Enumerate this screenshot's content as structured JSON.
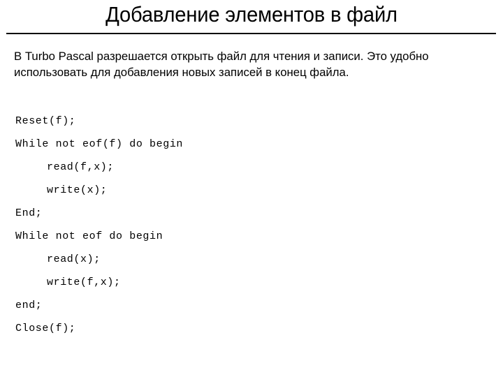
{
  "slide": {
    "title": "Добавление элементов в файл",
    "body_paragraph": "В Turbo Pascal разрешается открыть файл для чтения и записи. Это удобно использовать для добавления новых записей в конец файла.",
    "code_lines": [
      {
        "text": "Reset(f);",
        "indent": false
      },
      {
        "text": "While not eof(f) do begin",
        "indent": false
      },
      {
        "text": "read(f,x);",
        "indent": true
      },
      {
        "text": "write(x);",
        "indent": true
      },
      {
        "text": "End;",
        "indent": false
      },
      {
        "text": "While not eof do begin",
        "indent": false
      },
      {
        "text": "read(x);",
        "indent": true
      },
      {
        "text": "write(f,x);",
        "indent": true
      },
      {
        "text": "end;",
        "indent": false
      },
      {
        "text": "Close(f);",
        "indent": false
      }
    ],
    "colors": {
      "background": "#ffffff",
      "text": "#000000",
      "rule": "#000000"
    }
  }
}
